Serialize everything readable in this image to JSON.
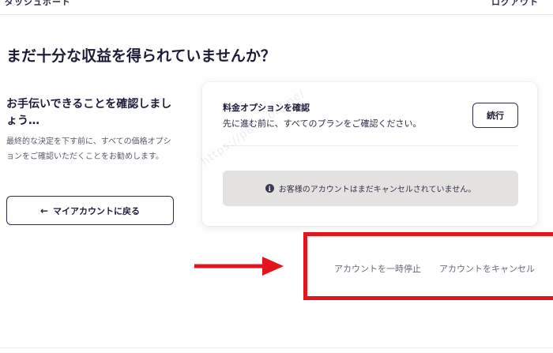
{
  "header": {
    "left_text": "ダッシュボード",
    "right_text": "ログアウト"
  },
  "page": {
    "title": "まだ十分な収益を得られていませんか？"
  },
  "help": {
    "heading": "お手伝いできることを確認しましょう…",
    "description": "最終的な決定を下す前に、すべての価格オプションをご確認いただくことをお勧めします。",
    "back_button_label": "マイアカウントに戻る",
    "back_icon": "arrow-left-icon"
  },
  "pricing_card": {
    "title": "料金オプションを確認",
    "description": "先に進む前に、すべてのプランをご確認ください。",
    "continue_label": "続行",
    "notice_text": "お客様のアカウントはまだキャンセルされていません。",
    "notice_icon": "info-icon"
  },
  "watermark": {
    "text": "https://p8ch.online/"
  },
  "actions": {
    "pause_label": "アカウントを一時停止",
    "cancel_label": "アカウントをキャンセル"
  },
  "colors": {
    "highlight": "#e3141b",
    "notice_bg": "#e4e2e0",
    "text_dark": "#1c1c38"
  }
}
